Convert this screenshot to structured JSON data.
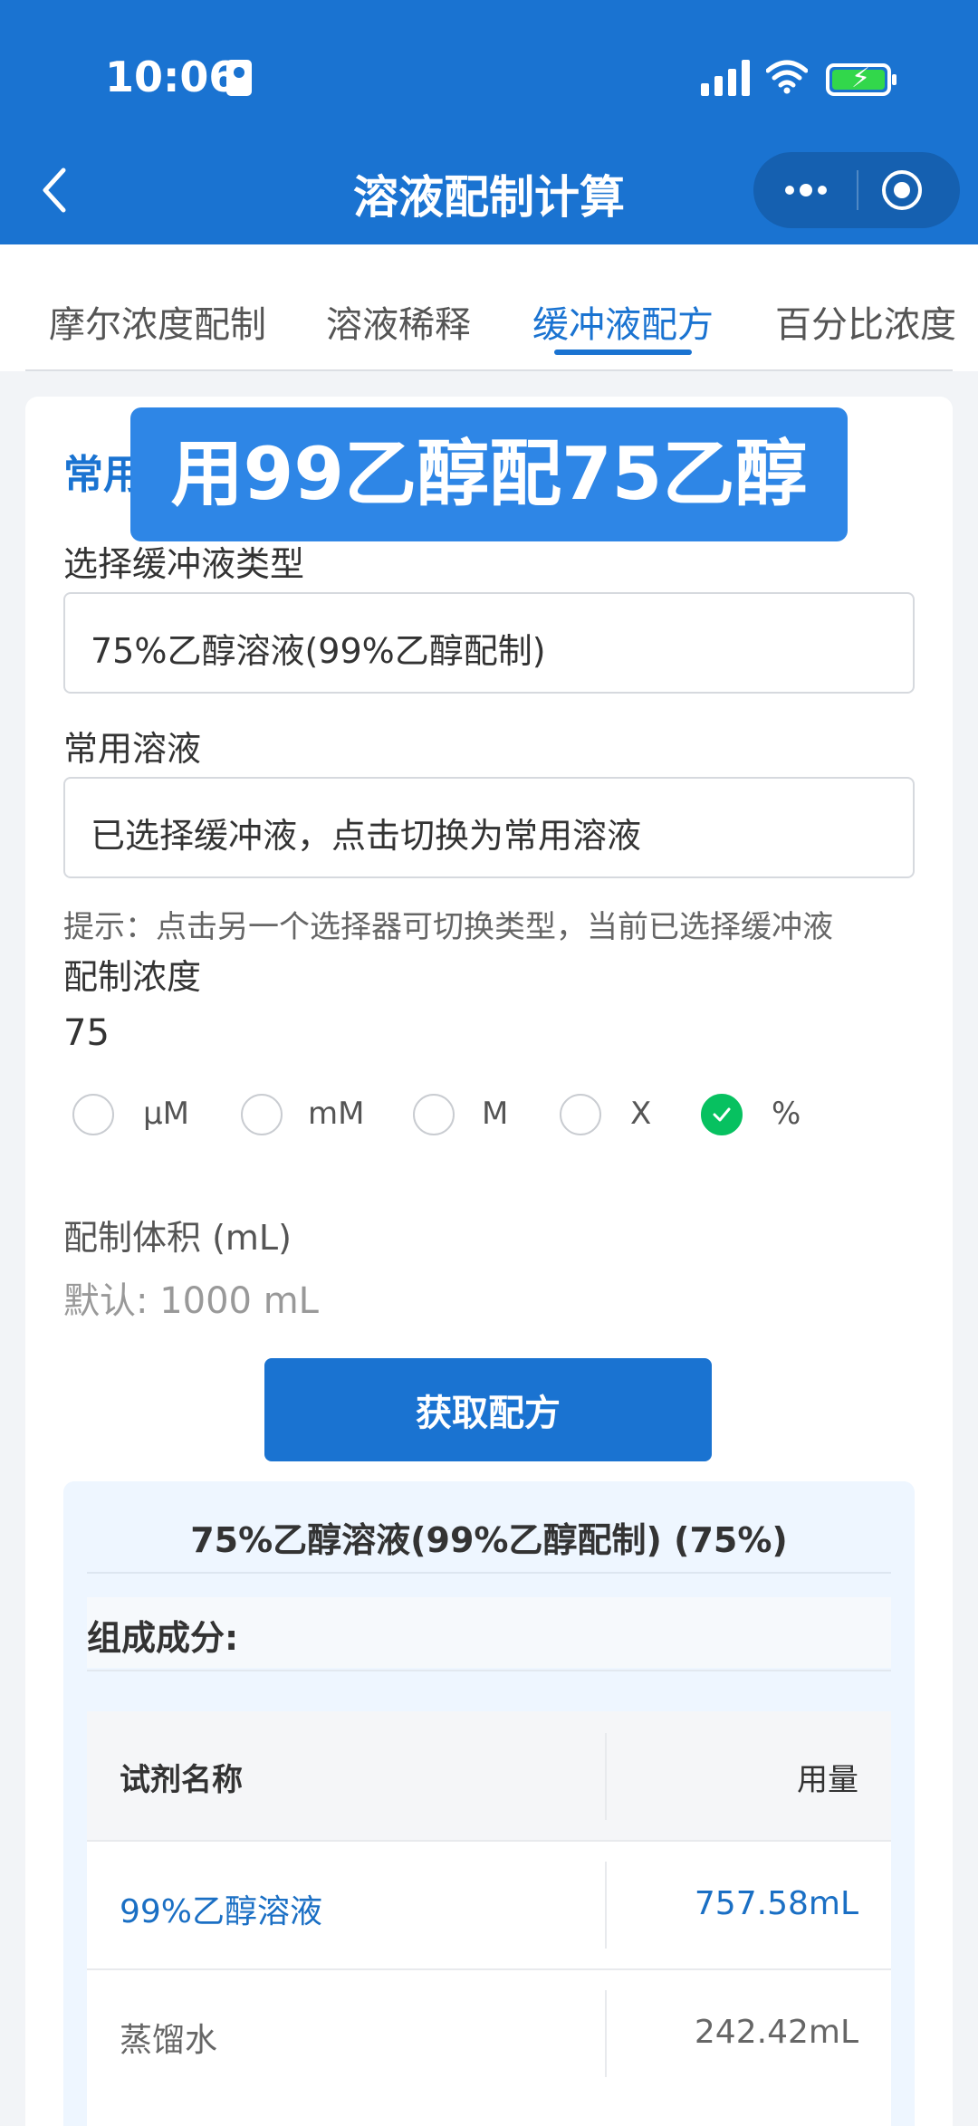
{
  "status_bar": {
    "time": "10:06"
  },
  "nav": {
    "title": "溶液配制计算"
  },
  "tabs": [
    {
      "label": "摩尔浓度配制"
    },
    {
      "label": "溶液稀释"
    },
    {
      "label": "缓冲液配方"
    },
    {
      "label": "百分比浓度"
    }
  ],
  "form": {
    "section_title": "常用",
    "overlay_text": "用99乙醇配75乙醇",
    "buffer_type_label": "选择缓冲液类型",
    "buffer_type_value": "75%乙醇溶液(99%乙醇配制)",
    "common_solution_label": "常用溶液",
    "common_solution_value": "已选择缓冲液，点击切换为常用溶液",
    "hint": "提示：点击另一个选择器可切换类型，当前已选择缓冲液",
    "concentration_label": "配制浓度",
    "concentration_value": "75",
    "units": [
      "μM",
      "mM",
      "M",
      "X",
      "%"
    ],
    "selected_unit": "%",
    "volume_label": "配制体积 (mL)",
    "volume_placeholder": "默认: 1000 mL",
    "submit_label": "获取配方"
  },
  "result": {
    "title": "75%乙醇溶液(99%乙醇配制) (75%)",
    "composition_label": "组成成分:",
    "table": {
      "headers": [
        "试剂名称",
        "用量"
      ],
      "rows": [
        {
          "name": "99%乙醇溶液",
          "amount": "757.58mL"
        },
        {
          "name": "蒸馏水",
          "amount": "242.42mL"
        }
      ]
    }
  },
  "colors": {
    "primary": "#1a73d1",
    "radio_checked": "#07c160",
    "result_bg": "#eef6ff",
    "highlight_text": "#1a6fc4"
  }
}
